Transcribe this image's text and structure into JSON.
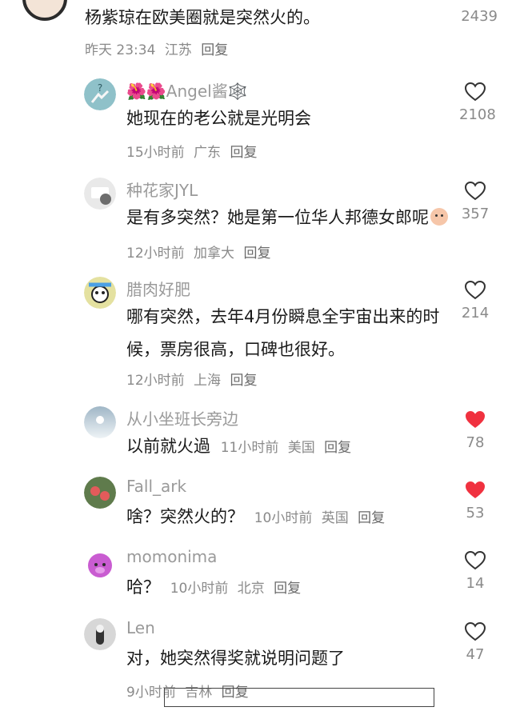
{
  "top_comment": {
    "text": "杨紫琼在欧美圈就是突然火的。",
    "time": "昨天 23:34",
    "location": "江苏",
    "reply_label": "回复",
    "likes": "2439"
  },
  "replies": [
    {
      "username": "🌺🌺Angel酱🕸️",
      "content": "她现在的老公就是光明会",
      "time": "15小时前",
      "location": "广东",
      "reply_label": "回复",
      "likes": "2108",
      "liked": false
    },
    {
      "username": "种花家JYL",
      "content": "是有多突然？她是第一位华人邦德女郎呢",
      "time": "12小时前",
      "location": "加拿大",
      "reply_label": "回复",
      "likes": "357",
      "liked": false
    },
    {
      "username": "腊肉好肥",
      "content": "哪有突然，去年4月份瞬息全宇宙出来的时候，票房很高，口碑也很好。",
      "time": "12小时前",
      "location": "上海",
      "reply_label": "回复",
      "likes": "214",
      "liked": false
    },
    {
      "username": "从小坐班长旁边",
      "content": "以前就火過",
      "time": "11小时前",
      "location": "美国",
      "reply_label": "回复",
      "likes": "78",
      "liked": true
    },
    {
      "username": "Fall_ark",
      "content": "啥？突然火的？",
      "time": "10小时前",
      "location": "英国",
      "reply_label": "回复",
      "likes": "53",
      "liked": true
    },
    {
      "username": "momonima",
      "content": "哈？",
      "time": "10小时前",
      "location": "北京",
      "reply_label": "回复",
      "likes": "14",
      "liked": false
    },
    {
      "username": "Len",
      "content": "对，她突然得奖就说明问题了",
      "time": "9小时前",
      "location": "吉林",
      "reply_label": "回复",
      "likes": "47",
      "liked": false
    }
  ],
  "colors": {
    "text": "#1a1a1a",
    "meta": "#8a8a8a",
    "liked_heart": "#f0313f",
    "unliked_heart": "#333333"
  }
}
